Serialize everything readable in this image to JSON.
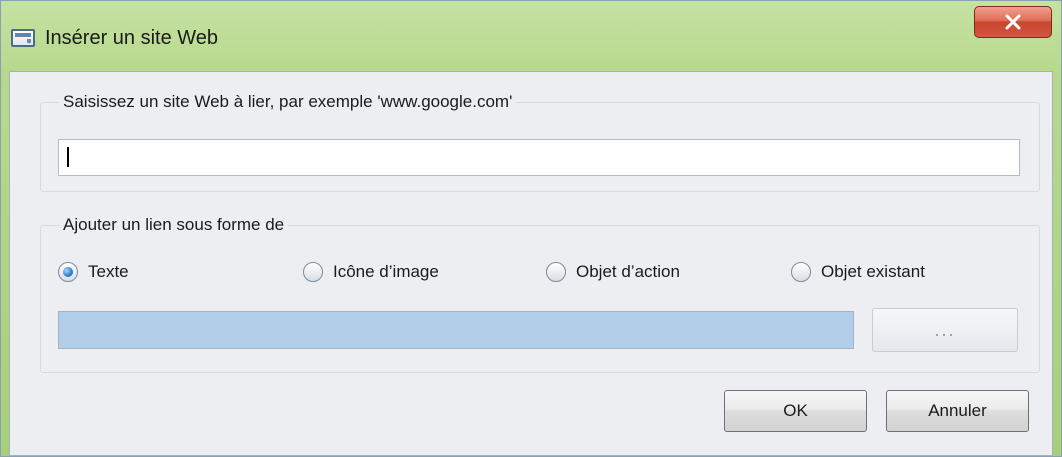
{
  "window": {
    "title": "Insérer un site Web"
  },
  "icons": {
    "app": "dialog-window-icon",
    "close": "close-icon"
  },
  "colors": {
    "title_bar": "#b7d98e",
    "close_button": "#d3563f",
    "client_bg": "#eceef1",
    "preview_field": "#b3cee9",
    "radio_selected": "#2d7dd3"
  },
  "url_group": {
    "legend": "Saisissez un site Web à lier, par exemple 'www.google.com'",
    "input_value": ""
  },
  "link_group": {
    "legend": "Ajouter un lien sous forme de",
    "options": [
      {
        "label": "Texte",
        "selected": true
      },
      {
        "label": "Icône d’image",
        "selected": false
      },
      {
        "label": "Objet d’action",
        "selected": false
      },
      {
        "label": "Objet existant",
        "selected": false
      }
    ],
    "browse_label": "..."
  },
  "buttons": {
    "ok": "OK",
    "cancel": "Annuler"
  }
}
